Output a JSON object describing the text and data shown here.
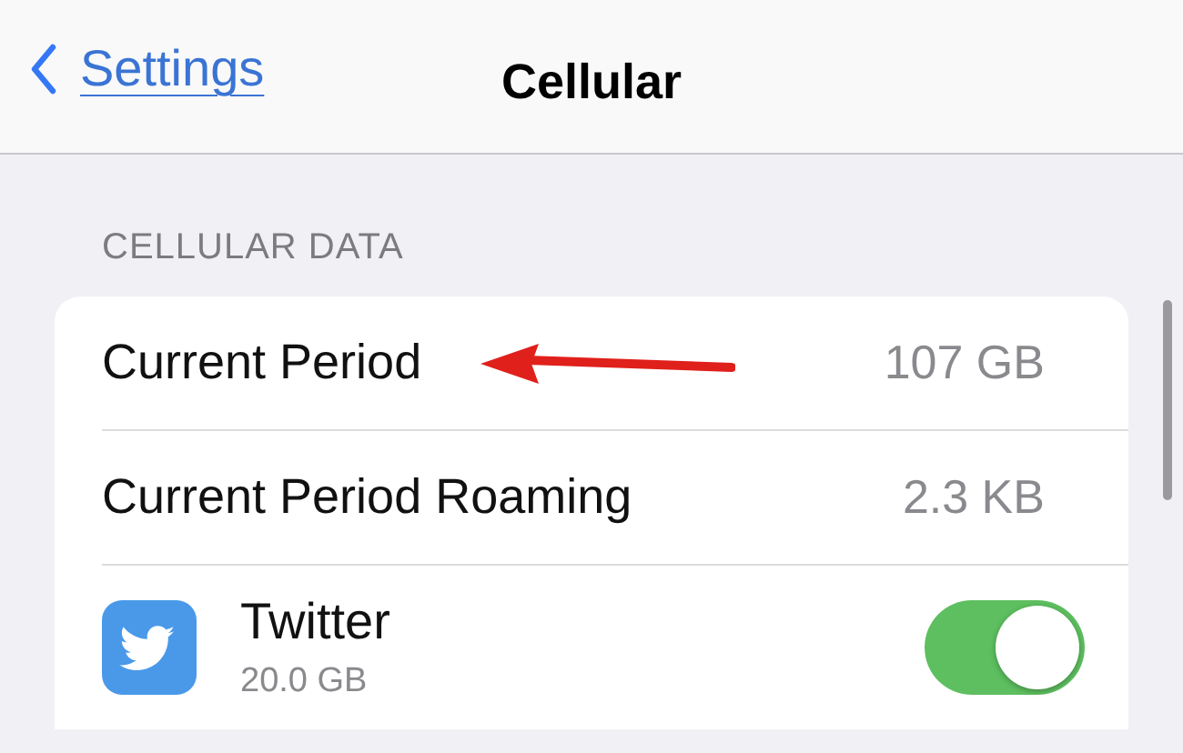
{
  "nav": {
    "back": "Settings",
    "title": "Cellular"
  },
  "section": {
    "header": "CELLULAR DATA"
  },
  "rows": [
    {
      "kind": "value",
      "label": "Current Period",
      "value": "107 GB"
    },
    {
      "kind": "value",
      "label": "Current Period Roaming",
      "value": "2.3 KB"
    },
    {
      "kind": "app",
      "label": "Twitter",
      "value": "20.0 GB",
      "on": true
    }
  ]
}
